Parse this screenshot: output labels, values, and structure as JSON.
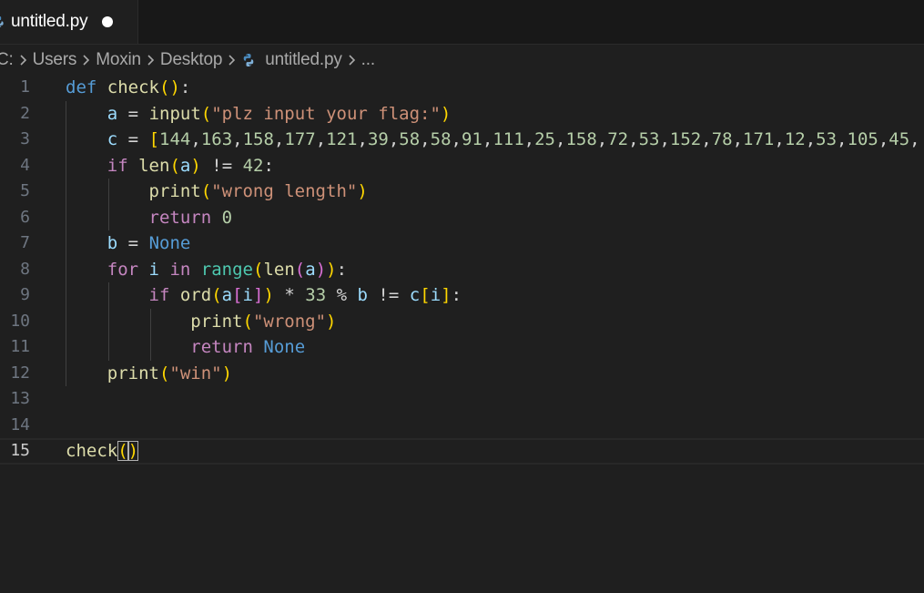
{
  "tab": {
    "label": "untitled.py",
    "icon": "python-file-icon",
    "dirty": true
  },
  "breadcrumb": {
    "items": [
      "C:",
      "Users",
      "Moxin",
      "Desktop"
    ],
    "file": "untitled.py",
    "more": "..."
  },
  "editor": {
    "language": "python",
    "active_line": 15,
    "line_numbers": [
      "1",
      "2",
      "3",
      "4",
      "5",
      "6",
      "7",
      "8",
      "9",
      "10",
      "11",
      "12",
      "13",
      "14",
      "15"
    ],
    "lines": [
      "def check():",
      "    a = input(\"plz input your flag:\")",
      "    c = [144,163,158,177,121,39,58,58,91,111,25,158,72,53,152,78,171,12,53,105,45,",
      "    if len(a) != 42:",
      "        print(\"wrong length\")",
      "        return 0",
      "    b = None",
      "    for i in range(len(a)):",
      "        if ord(a[i]) * 33 % b != c[i]:",
      "            print(\"wrong\")",
      "            return None",
      "    print(\"win\")",
      "",
      "",
      "check()"
    ]
  },
  "colors": {
    "background": "#1f1f1f",
    "tab_bar": "#181818",
    "keyword": "#569cd6",
    "control": "#c586c0",
    "function": "#dcdcaa",
    "variable": "#9cdcfe",
    "string": "#ce9178",
    "number": "#b5cea8",
    "builtin_class": "#4ec9b0",
    "bracket_level1": "#ffd700",
    "bracket_level2": "#da70d6",
    "bracket_level3": "#179fff"
  }
}
